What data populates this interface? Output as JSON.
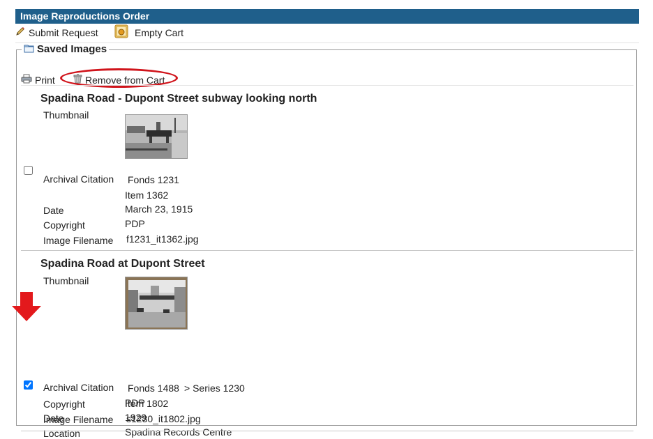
{
  "header": {
    "title": "Image Reproductions Order"
  },
  "toolbar": {
    "submit_label": "Submit Request",
    "empty_cart_label": "Empty Cart"
  },
  "saved": {
    "legend": "Saved Images",
    "print_label": "Print",
    "remove_label": "Remove from Cart",
    "accent_color": "#d0141b"
  },
  "records": [
    {
      "title": "Spadina Road - Dupont Street subway looking north",
      "checked": false,
      "thumbnail_label": "Thumbnail",
      "citation_label": "Archival Citation",
      "fonds": "Fonds 1231",
      "item": "Item 1362",
      "date_label": "Date",
      "date": "March 23, 1915",
      "copyright_label": "Copyright",
      "copyright": "PDP",
      "filename_label": "Image Filename",
      "filename": "f1231_it1362.jpg"
    },
    {
      "title": "Spadina Road at Dupont Street",
      "checked": true,
      "thumbnail_label": "Thumbnail",
      "citation_label": "Archival Citation",
      "fonds": "Fonds 1488",
      "series": "> Series 1230",
      "item": "Item 1802",
      "date_label": "Date",
      "date": "1929",
      "location_label": "Location",
      "location": "Spadina Records Centre",
      "copyright_label": "Copyright",
      "copyright": "PDP",
      "filename_label": "Image Filename",
      "filename": "s1230_it1802.jpg"
    }
  ]
}
